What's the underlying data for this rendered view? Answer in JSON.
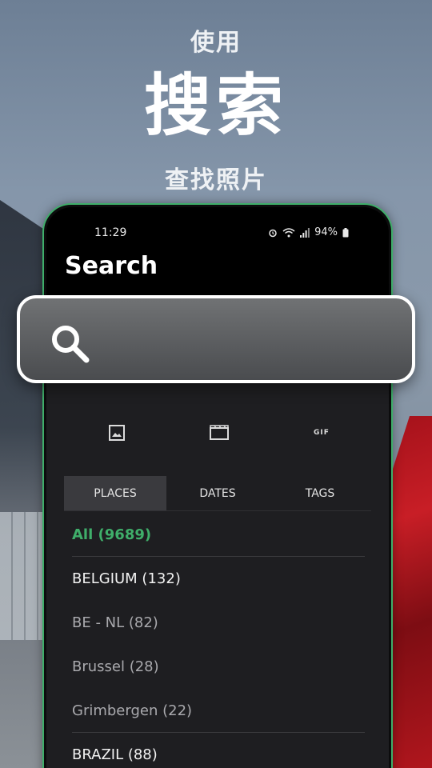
{
  "promo": {
    "top": "使用",
    "main": "搜索",
    "sub": "查找照片"
  },
  "status_bar": {
    "time": "11:29",
    "battery": "94%",
    "icons": [
      "alarm-icon",
      "wifi-icon",
      "signal-icon",
      "battery-icon"
    ]
  },
  "screen": {
    "title": "Search"
  },
  "search": {
    "placeholder": ""
  },
  "media_types": [
    {
      "name": "photos",
      "icon": "image-icon"
    },
    {
      "name": "videos",
      "icon": "video-icon"
    },
    {
      "name": "gifs",
      "label": "GIF"
    }
  ],
  "tabs": [
    {
      "label": "PLACES",
      "active": true
    },
    {
      "label": "DATES",
      "active": false
    },
    {
      "label": "TAGS",
      "active": false
    }
  ],
  "places": [
    {
      "label": "All (9689)"
    },
    {
      "label": "BELGIUM (132)"
    },
    {
      "label": "BE - NL (82)"
    },
    {
      "label": "Brussel (28)"
    },
    {
      "label": "Grimbergen (22)"
    },
    {
      "label": "BRAZIL (88)"
    }
  ],
  "colors": {
    "accent": "#3fae6a",
    "phone_bg": "#1e1e21",
    "tab_active_bg": "#3a3a3e"
  }
}
